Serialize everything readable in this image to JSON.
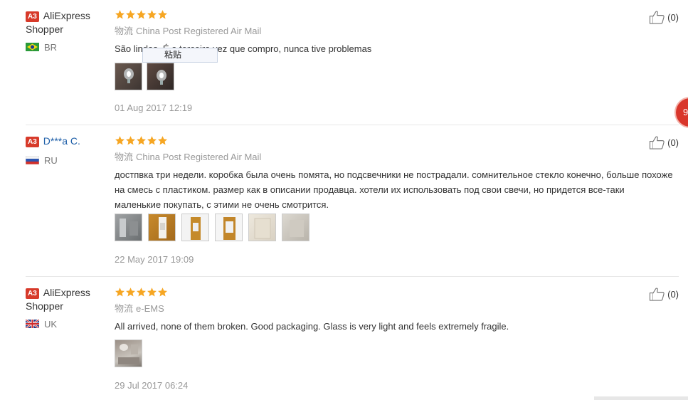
{
  "reviews": [
    {
      "level": "A3",
      "user": "AliExpress Shopper",
      "country": "BR",
      "rating": 5,
      "ship_label": "物流",
      "ship_method": "China Post Registered Air Mail",
      "text": "São lindas. É a terceira vez que compro, nunca tive problemas",
      "photo_count": 2,
      "date": "01 Aug 2017 12:19",
      "helpful": "(0)"
    },
    {
      "level": "A3",
      "user": "D***a C.",
      "country": "RU",
      "rating": 5,
      "ship_label": "物流",
      "ship_method": "China Post Registered Air Mail",
      "text": "достпвка три недели. коробка была очень помята, но подсвечники не пострадали. сомнительное стекло конечно, больше похоже на смесь с пластиком. размер как в описании продавца. хотели их использовать под свои свечи, но придется все-таки маленькие покупать, с этими не очень смотрится.",
      "photo_count": 6,
      "date": "22 May 2017 19:09",
      "helpful": "(0)"
    },
    {
      "level": "A3",
      "user": "AliExpress Shopper",
      "country": "UK",
      "rating": 5,
      "ship_label": "物流",
      "ship_method": "e-EMS",
      "text": "All arrived, none of them broken. Good packaging. Glass is very light and feels extremely fragile.",
      "photo_count": 1,
      "date": "29 Jul 2017 06:24",
      "helpful": "(0)"
    }
  ],
  "tooltip": "粘贴",
  "badge": "9",
  "icons": {
    "rating": "star-icon",
    "helpful": "thumbs-up-icon"
  },
  "colors": {
    "star": "#f6a623",
    "level_badge": "#d73a2a",
    "user_link": "#1d5ea8"
  }
}
